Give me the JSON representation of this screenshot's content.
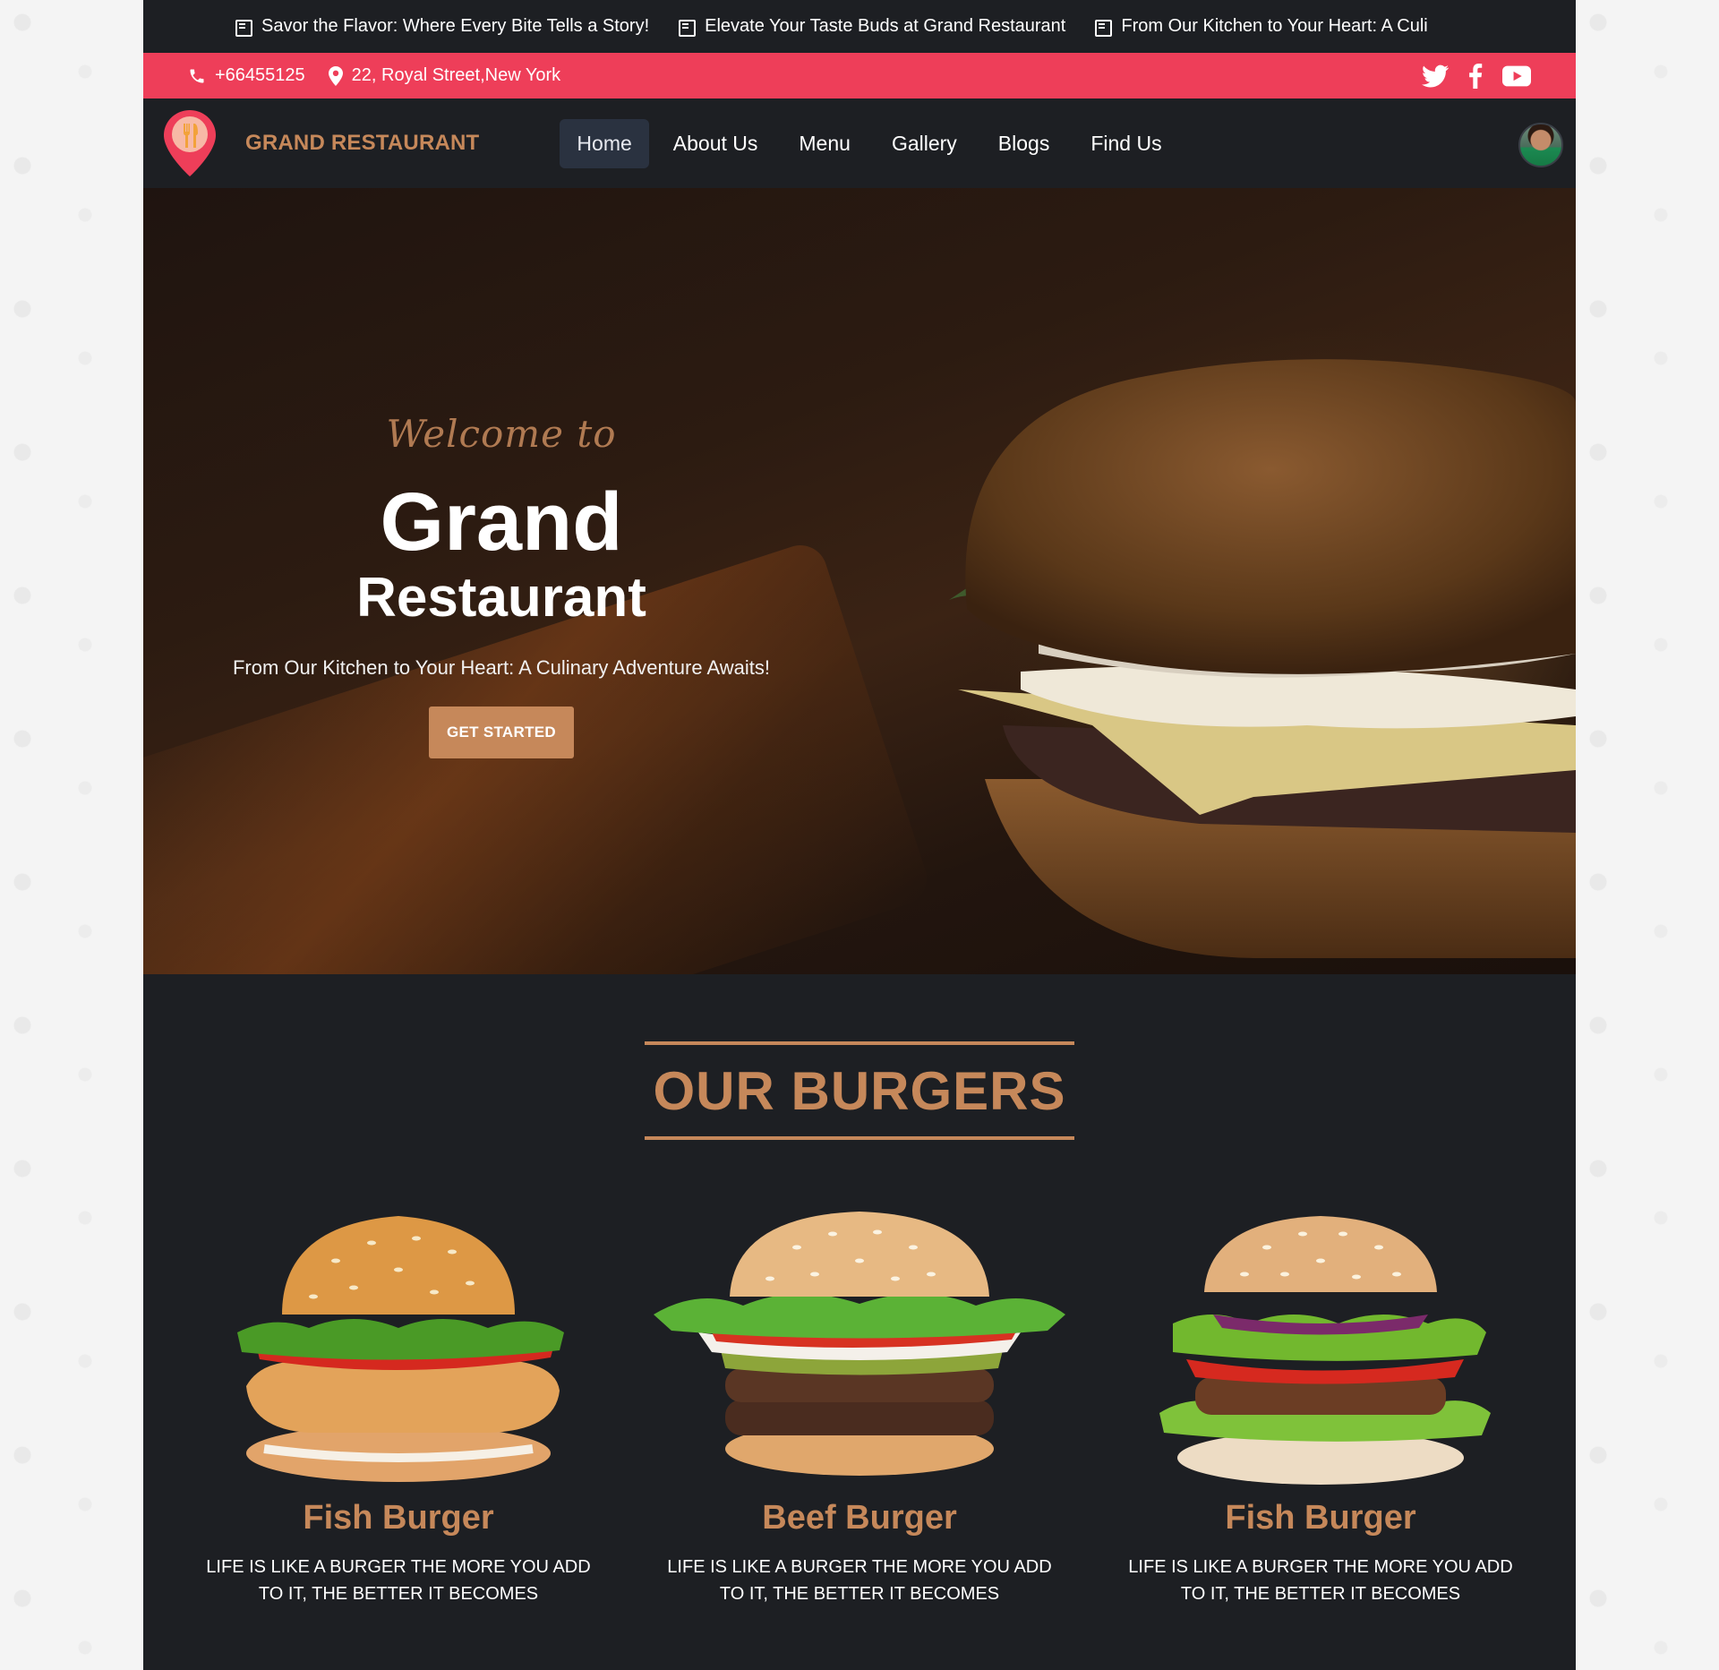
{
  "ticker": [
    "Savor the Flavor: Where Every Bite Tells a Story!",
    "Elevate Your Taste Buds at Grand Restaurant",
    "From Our Kitchen to Your Heart: A Culi"
  ],
  "contact": {
    "phone": "+66455125",
    "address": "22, Royal Street,New York"
  },
  "social_icons": [
    "twitter-icon",
    "facebook-icon",
    "youtube-icon"
  ],
  "nav": {
    "brand": "GRAND RESTAURANT",
    "items": [
      "Home",
      "About Us",
      "Menu",
      "Gallery",
      "Blogs",
      "Find Us"
    ],
    "active": "Home"
  },
  "hero": {
    "welcome": "Welcome to",
    "title_line1": "Grand",
    "title_line2": "Restaurant",
    "subtitle": "From Our Kitchen to Your Heart: A Culinary Adventure Awaits!",
    "cta": "GET STARTED"
  },
  "burgers": {
    "heading": "OUR BURGERS",
    "items": [
      {
        "name": "Fish Burger",
        "desc": "LIFE IS LIKE A BURGER THE MORE YOU ADD TO IT, THE BETTER IT BECOMES"
      },
      {
        "name": "Beef Burger",
        "desc": "LIFE IS LIKE A BURGER THE MORE YOU ADD TO IT, THE BETTER IT BECOMES"
      },
      {
        "name": "Fish Burger",
        "desc": "LIFE IS LIKE A BURGER THE MORE YOU ADD TO IT, THE BETTER IT BECOMES"
      }
    ]
  },
  "colors": {
    "accent": "#c6885a",
    "contact_bar": "#ee3e59",
    "dark_bg": "#1d1f23",
    "page_bg": "#f4f4f4"
  }
}
